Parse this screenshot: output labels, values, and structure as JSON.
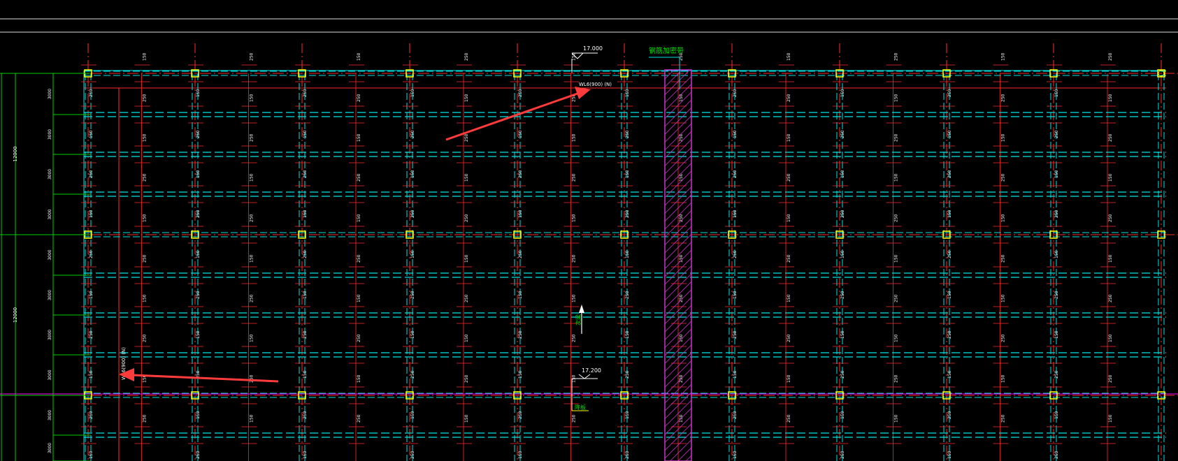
{
  "labels": {
    "elev_top": "17.000",
    "elev_mid": "17.200",
    "beam_callout": "WL6(900) (N)",
    "side_callout": "WL6(900) (N)",
    "band_label": "钢筋加密带",
    "arrow_label": "次梁",
    "ref_label": "降板"
  },
  "spans": {
    "left_outer": [
      "12000",
      "12000"
    ],
    "left_inner": [
      "3000",
      "3000",
      "3000",
      "3000",
      "3000",
      "3000",
      "3000",
      "3000",
      "3000",
      "3000"
    ]
  },
  "slab_tags": [
    "250",
    "150",
    "250",
    "150"
  ],
  "colors": {
    "background": "#000000",
    "axis_red": "#ff2a2a",
    "beam_cyan": "#00e5e5",
    "column_yellow": "#ffff00",
    "dim_green": "#00cc00",
    "axis_magenta": "#ff00ff",
    "hatch_magenta": "#cc33cc",
    "arrow_red": "#ff3b3b",
    "text_white": "#ffffff"
  }
}
